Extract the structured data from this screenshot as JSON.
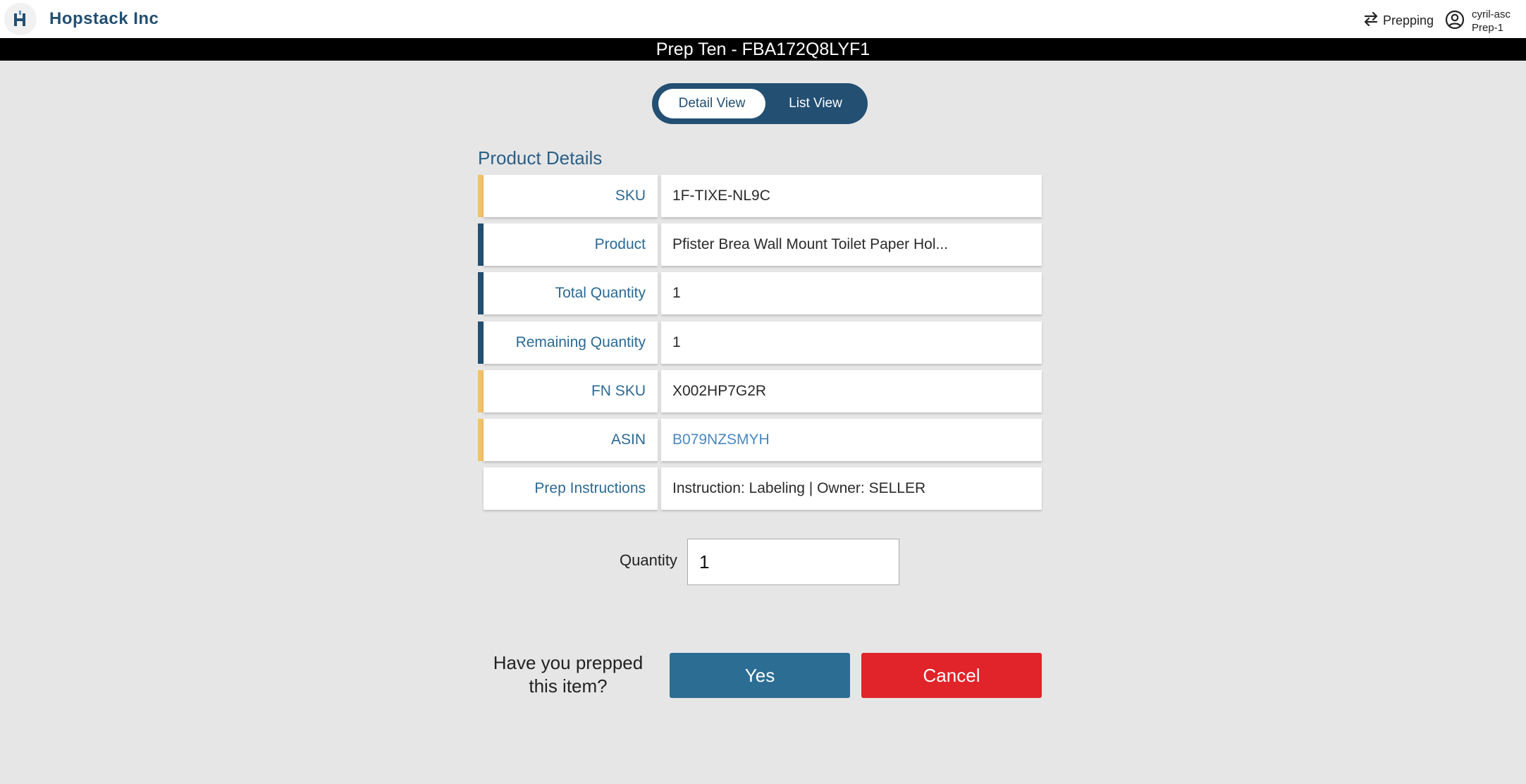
{
  "header": {
    "brand_name": "Hopstack Inc",
    "logo_glyph": "H",
    "mode_label": "Prepping",
    "user_name": "cyril-asc",
    "user_station": "Prep-1"
  },
  "title_bar": {
    "title": "Prep Ten - FBA172Q8LYF1"
  },
  "view_toggle": {
    "detail_label": "Detail View",
    "list_label": "List View",
    "active": "Detail View"
  },
  "product_details": {
    "title": "Product Details",
    "rows": [
      {
        "label": "SKU",
        "value": "1F-TIXE-NL9C",
        "accent": "#f2c268"
      },
      {
        "label": "Product",
        "value": "Pfister Brea Wall Mount Toilet Paper Hol...",
        "accent": "#224f72"
      },
      {
        "label": "Total Quantity",
        "value": "1",
        "accent": "#224f72"
      },
      {
        "label": "Remaining Quantity",
        "value": "1",
        "accent": "#224f72"
      },
      {
        "label": "FN SKU",
        "value": "X002HP7G2R",
        "accent": "#f2c268"
      },
      {
        "label": "ASIN",
        "value": "B079NZSMYH",
        "accent": "#f2c268"
      },
      {
        "label": "Prep Instructions",
        "value": "Instruction: Labeling | Owner: SELLER",
        "accent": ""
      }
    ]
  },
  "quantity": {
    "label": "Quantity",
    "value": "1"
  },
  "confirm": {
    "question_line1": "Have you prepped",
    "question_line2": "this item?",
    "yes_label": "Yes",
    "cancel_label": "Cancel"
  },
  "colors": {
    "brand": "#224f72",
    "yes_button": "#2c6d94",
    "cancel_button": "#e0242a",
    "accent_yellow": "#f2c268",
    "accent_navy": "#224f72"
  },
  "icons": {
    "mode": "swap-arrows-icon",
    "user": "user-circle-icon",
    "logo": "hopstack-logo-icon"
  }
}
